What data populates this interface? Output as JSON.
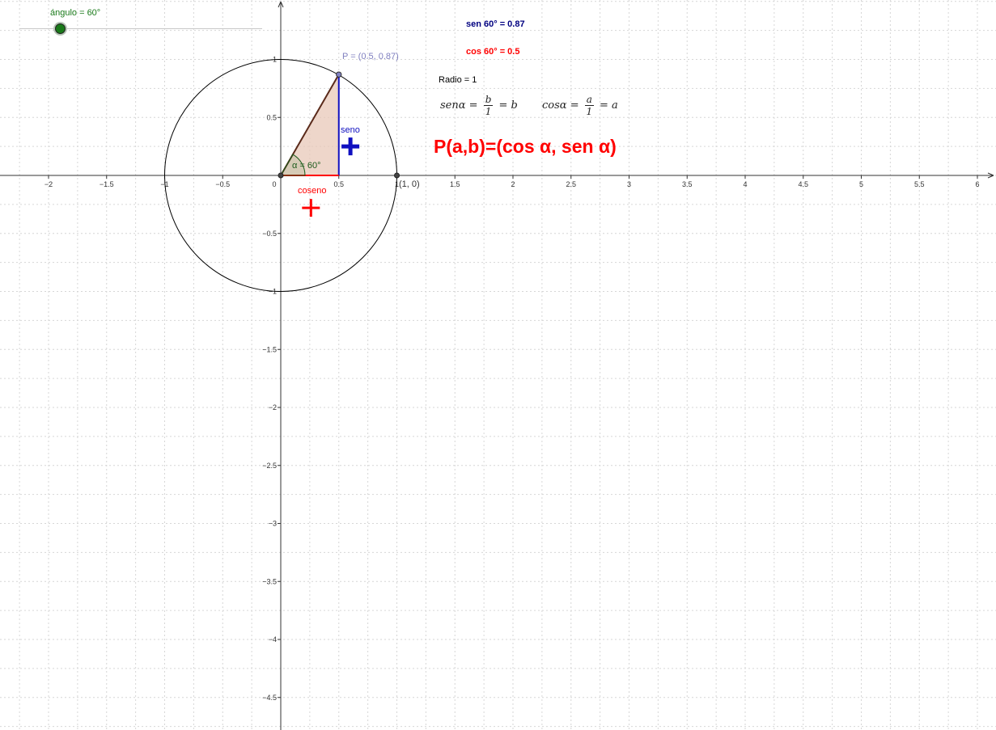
{
  "slider": {
    "label": "ángulo = 60°",
    "value_fraction": 0.167,
    "color": "#1a7a1a"
  },
  "sen_text": "sen 60° = 0.87",
  "cos_text": "cos 60° = 0.5",
  "radio_text": "Radio = 1",
  "formula_sen": {
    "lhs": "senα =",
    "num": "b",
    "den": "1",
    "rhs": "= b"
  },
  "formula_cos": {
    "lhs": "cosα =",
    "num": "a",
    "den": "1",
    "rhs": "= a"
  },
  "big_formula": "P(a,b)=(cos α, sen α)",
  "point_label": "P = (0.5, 0.87)",
  "seno_label": "seno",
  "coseno_label": "coseno",
  "angle_label": "α = 60°",
  "unit_point_label": "(1, 0)",
  "x_ticks": [
    "−2",
    "−1.5",
    "−1",
    "−0.5",
    "0",
    "0.5",
    "1",
    "1.5",
    "2",
    "2.5",
    "3",
    "3.5",
    "4",
    "4.5",
    "5",
    "5.5",
    "6"
  ],
  "y_ticks": [
    "1",
    "0.5",
    "−0.5",
    "−1",
    "−1.5",
    "−2",
    "−2.5",
    "−3",
    "−3.5",
    "−4",
    "−4.5"
  ],
  "chart_data": {
    "type": "scatter",
    "x_range": [
      -2.4,
      6.1
    ],
    "y_range": [
      -4.8,
      1.5
    ],
    "grid": true,
    "angle_deg": 60,
    "circle_radius": 1,
    "point": [
      0.5,
      0.87
    ],
    "unit_point": [
      1,
      0
    ]
  },
  "colors": {
    "sen": "#000080",
    "cos": "#ff0000",
    "point": "#8080c0",
    "seno": "#1010c0",
    "angle": "#1a5a1a",
    "fill": "#e8c8b8",
    "axis": "#333333"
  }
}
